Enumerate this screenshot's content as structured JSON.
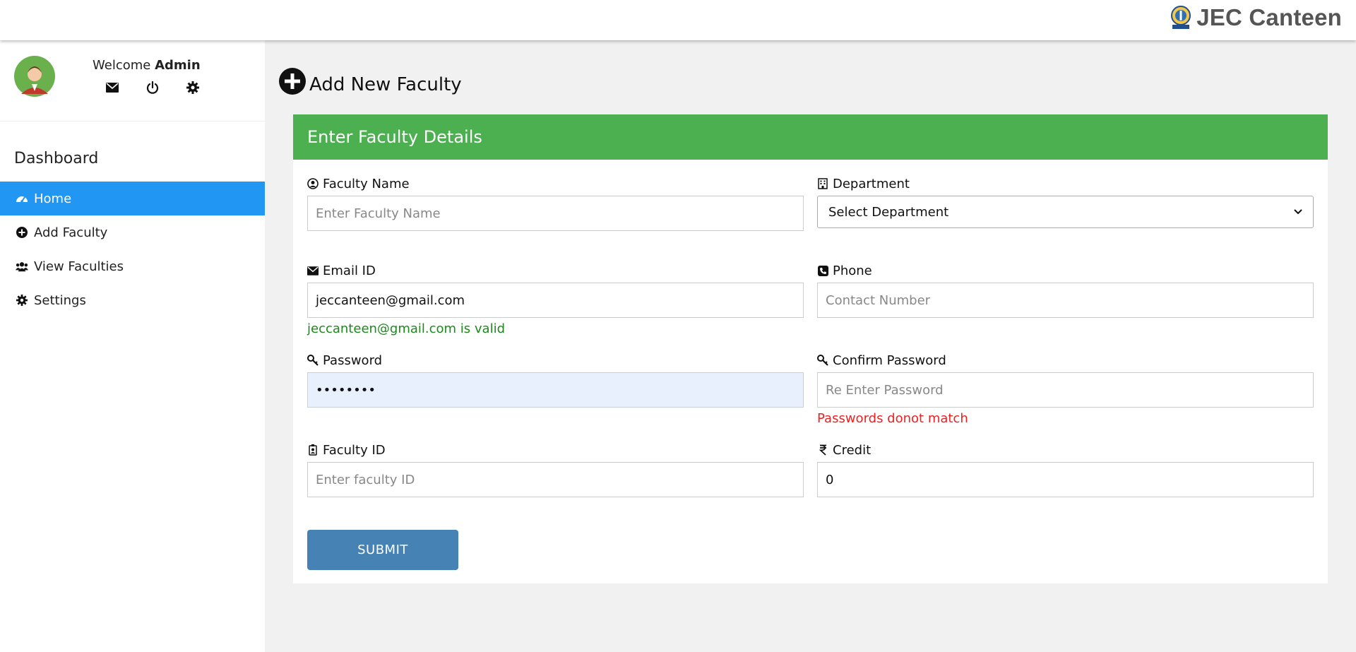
{
  "header": {
    "brand_title": "JEC Canteen"
  },
  "sidebar": {
    "welcome_prefix": "Welcome",
    "user_name": "Admin",
    "dashboard_title": "Dashboard",
    "items": [
      {
        "label": "Home",
        "icon": "dashboard-icon",
        "active": true
      },
      {
        "label": "Add Faculty",
        "icon": "plus-circle-icon"
      },
      {
        "label": "View Faculties",
        "icon": "users-icon"
      },
      {
        "label": "Settings",
        "icon": "gear-icon"
      }
    ]
  },
  "page": {
    "title": "Add New Faculty"
  },
  "form": {
    "header": "Enter Faculty Details",
    "faculty_name": {
      "label": "Faculty Name",
      "placeholder": "Enter Faculty Name"
    },
    "department": {
      "label": "Department",
      "selected": "Select Department"
    },
    "email": {
      "label": "Email ID",
      "value": "jeccanteen@gmail.com",
      "message": "jeccanteen@gmail.com is valid"
    },
    "phone": {
      "label": "Phone",
      "placeholder": "Contact Number"
    },
    "password": {
      "label": "Password",
      "value": "••••••••"
    },
    "confirm_password": {
      "label": "Confirm Password",
      "placeholder": "Re Enter Password",
      "message": "Passwords donot match"
    },
    "faculty_id": {
      "label": "Faculty ID",
      "placeholder": "Enter faculty ID"
    },
    "credit": {
      "label": "Credit",
      "value": "0"
    },
    "submit_label": "SUBMIT"
  },
  "colors": {
    "accent": "#2196f3",
    "card_header": "#4caf50",
    "submit": "#4682b4",
    "valid": "#1b8a1b",
    "error": "#f01f1f"
  }
}
